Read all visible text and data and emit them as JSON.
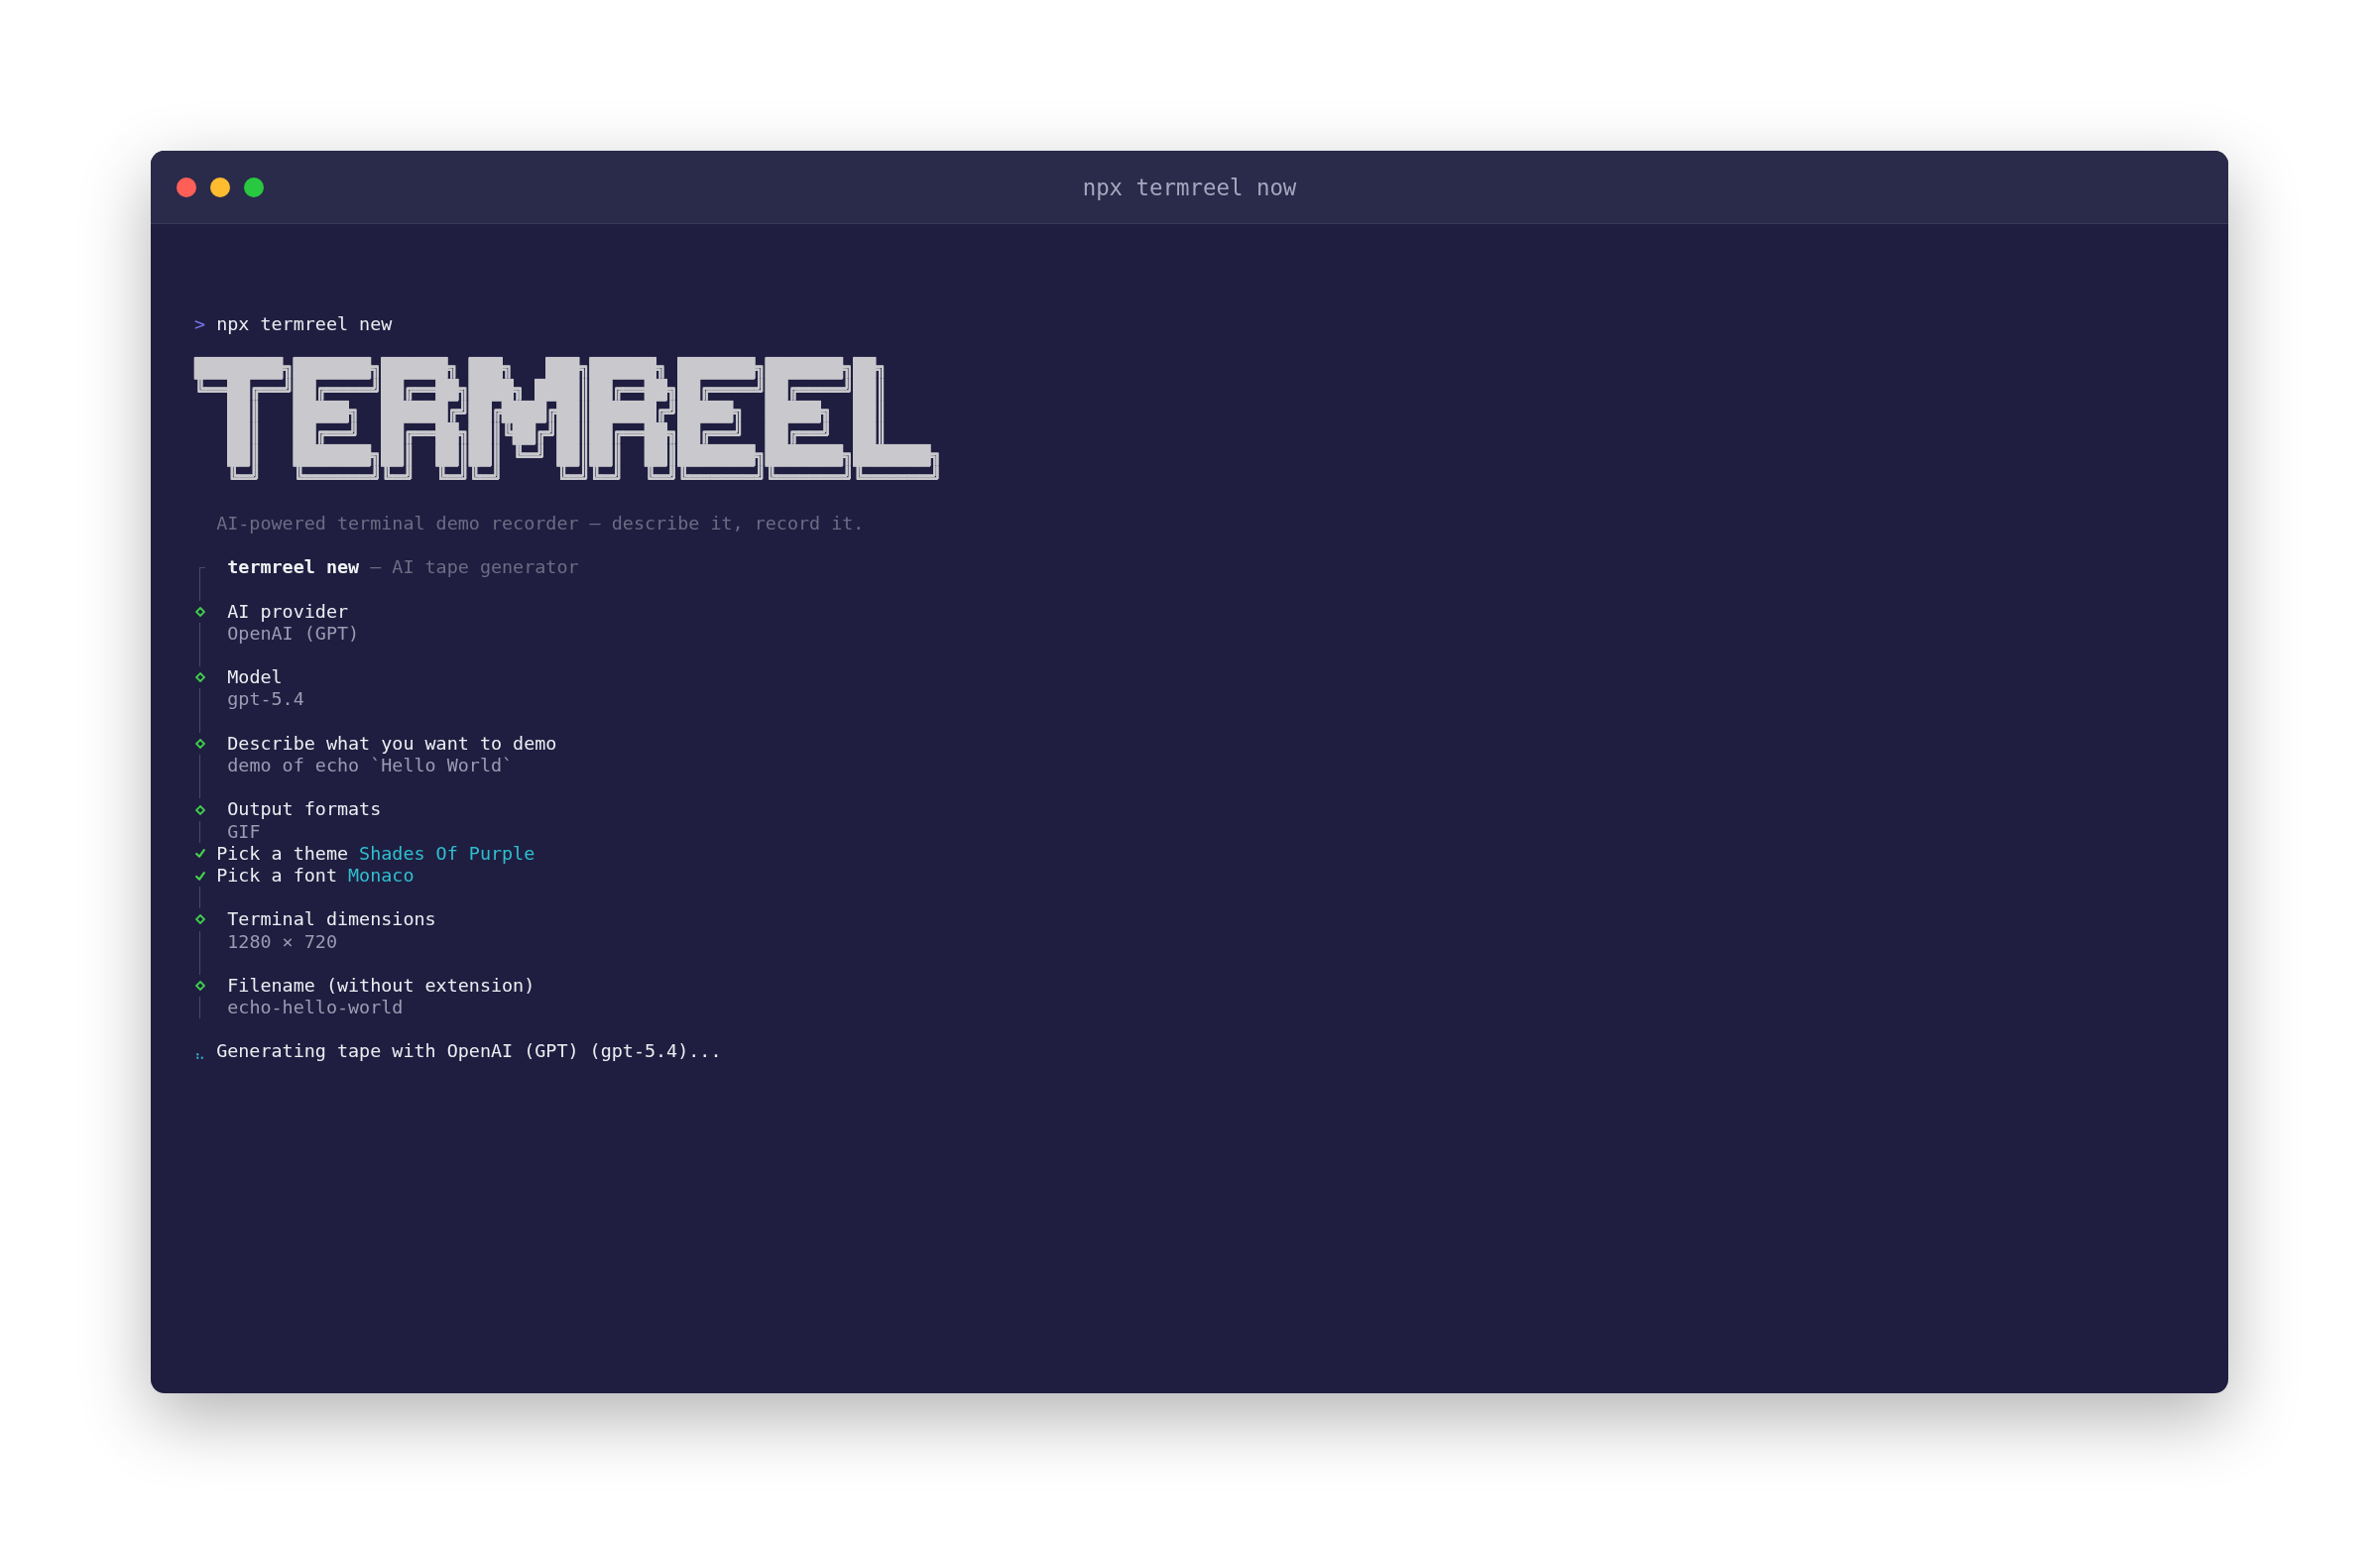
{
  "window": {
    "title": "npx termreel now",
    "controls": [
      {
        "color": "#ff5f57"
      },
      {
        "color": "#febc2e"
      },
      {
        "color": "#28c840"
      }
    ]
  },
  "terminal": {
    "command": {
      "prompt": ">",
      "text": "npx termreel new"
    },
    "banner": {
      "art": [
        "████████╗███████╗██████╗ ███╗   ███╗██████╗ ███████╗███████╗██╗",
        "╚══██╔══╝██╔════╝██╔══██╗████╗ ████║██╔══██╗██╔════╝██╔════╝██║",
        "   ██║   █████╗  ██████╔╝██╔████╔██║██████╔╝█████╗  █████╗  ██║",
        "   ██║   ██╔══╝  ██╔══██╗██║╚██╔╝██║██╔══██╗██╔══╝  ██╔══╝  ██║",
        "   ██║   ███████╗██║  ██║██║ ╚═╝ ██║██║  ██║███████╗███████╗███████╗",
        "   ╚═╝   ╚══════╝╚═╝  ╚═╝╚═╝     ╚═╝╚═╝  ╚═╝╚══════╝╚══════╝╚══════╝"
      ]
    },
    "tagline": "AI-powered terminal demo recorder — describe it, record it.",
    "session": {
      "title": "termreel new",
      "subtitle": "— AI tape generator"
    },
    "steps": [
      {
        "kind": "answered",
        "label": "AI provider",
        "value": "OpenAI (GPT)"
      },
      {
        "kind": "answered",
        "label": "Model",
        "value": "gpt-5.4"
      },
      {
        "kind": "answered",
        "label": "Describe what you want to demo",
        "value": "demo of echo `Hello World`"
      },
      {
        "kind": "answered",
        "label": "Output formats",
        "value": "GIF"
      },
      {
        "kind": "picked",
        "label": "Pick a theme",
        "value": "Shades Of Purple"
      },
      {
        "kind": "picked",
        "label": "Pick a font",
        "value": "Monaco"
      },
      {
        "kind": "answered",
        "label": "Terminal dimensions",
        "value": "1280 × 720"
      },
      {
        "kind": "answered",
        "label": "Filename (without extension)",
        "value": "echo-hello-world"
      }
    ],
    "status": {
      "kind": "spinner",
      "text": "Generating tape with OpenAI (GPT) (gpt-5.4)..."
    }
  }
}
